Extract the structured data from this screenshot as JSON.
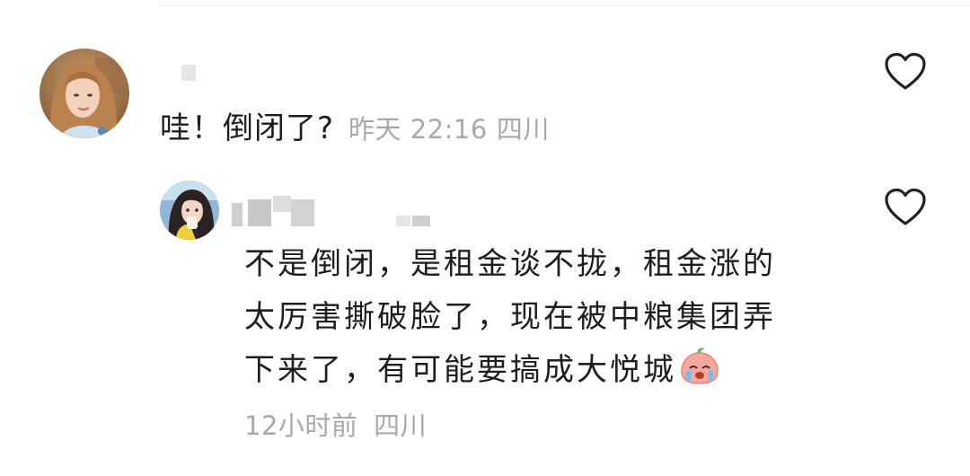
{
  "comment_1": {
    "text": "哇！倒闭了?",
    "time": "昨天 22:16",
    "location": "四川",
    "like_icon": "heart-outline-icon",
    "avatar": "woman-long-hair-avatar"
  },
  "comment_2": {
    "lines": [
      "不是倒闭，是租金谈不拢，租金涨的",
      "太厉害撕破脸了，现在被中粮集团弄",
      "下来了，有可能要搞成大悦城"
    ],
    "emoji": "crying-face-emoji",
    "time": "12小时前",
    "location": "四川",
    "like_icon": "heart-outline-icon",
    "avatar": "woman-selfie-avatar"
  },
  "colors": {
    "text": "#1e1e1e",
    "meta": "#a9a9a9",
    "icon": "#222222",
    "background": "#ffffff"
  }
}
